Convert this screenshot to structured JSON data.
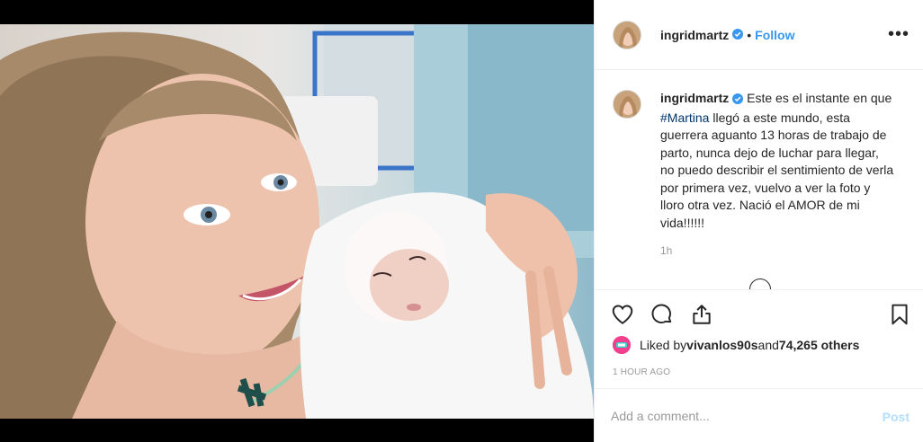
{
  "post": {
    "username": "ingridmartz",
    "separator": "•",
    "follow_label": "Follow",
    "more_label": "•••"
  },
  "caption": {
    "username": "ingridmartz",
    "text_before": "Este es el instante en que ",
    "hashtag": "#Martina",
    "text_after": " llegó a este mundo, esta guerrera aguanto 13 horas de trabajo de parto, nunca dejo de luchar para llegar, no puedo describir el sentimiento de verla por primera vez, vuelvo a ver la foto y lloro otra vez. Nació el AMOR de mi vida!!!!!!",
    "time": "1h"
  },
  "likes": {
    "prefix": "Liked by ",
    "liker": "vivanlos90s",
    "middle": " and ",
    "count": "74,265 others"
  },
  "timestamp": "1 HOUR AGO",
  "comment": {
    "placeholder": "Add a comment...",
    "post_label": "Post"
  },
  "icons": {
    "like": "heart-icon",
    "comment": "comment-icon",
    "share": "share-icon",
    "save": "bookmark-icon",
    "verified": "verified-badge-icon"
  },
  "colors": {
    "link_blue": "#3897f0",
    "verified_blue": "#3897f0",
    "muted": "#999999",
    "border": "#efefef",
    "post_disabled": "#b2dffc"
  }
}
